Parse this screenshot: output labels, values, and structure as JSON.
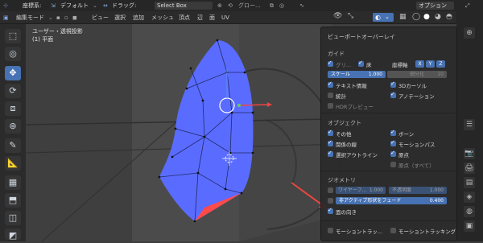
{
  "topbar": {
    "coord_label": "座標系:",
    "coord_value": "デフォルト",
    "drag_label": "ドラッグ:",
    "drag_value": "Select Box",
    "pivot_value": "グロー...",
    "options_label": "オプション"
  },
  "header": {
    "mode_label": "編集モード",
    "menus": [
      "ビュー",
      "選択",
      "追加",
      "メッシュ",
      "頂点",
      "辺",
      "面",
      "UV"
    ]
  },
  "viewport": {
    "view_name": "ユーザー・透視投影",
    "object_name": "(1) 平面"
  },
  "overlay_panel": {
    "title": "ビューポートオーバーレイ",
    "guides": {
      "section": "ガイド",
      "grid_label": "グリ...",
      "floor_label": "床",
      "axes_label": "座標軸",
      "axes": [
        "X",
        "Y",
        "Z"
      ],
      "scale_label": "スケール",
      "scale_value": "1.000",
      "subdiv_label": "細分化",
      "subdiv_value": "10",
      "text_info": "テキスト情報",
      "cursor_3d": "3Dカーソル",
      "statistics": "統計",
      "annotation": "アノテーション",
      "hdri_preview": "HDRプレビュー"
    },
    "objects": {
      "section": "オブジェクト",
      "extras": "その他",
      "bones": "ボーン",
      "relationship_lines": "関係の線",
      "motion_paths": "モーションパス",
      "outline_selected": "選択アウトライン",
      "origins": "原点",
      "origins_all": "原点（すべて）"
    },
    "geometry": {
      "section": "ジオメトリ",
      "wireframe_label": "ワイヤーフ...",
      "wireframe_value": "1.000",
      "opacity_label": "不透明度",
      "opacity_value": "1.000",
      "fade_label": "非アクティブ形状をフェード",
      "fade_value": "0.400",
      "face_orientation": "面の向き"
    },
    "motion_tracking_short": "モーショントラッ...",
    "motion_tracking": "モーショントラッキング"
  },
  "colors": {
    "accent": "#4772b3",
    "face_front": "#5a6cff",
    "face_back": "#ff4a4a",
    "arrow": "#e8473f"
  }
}
